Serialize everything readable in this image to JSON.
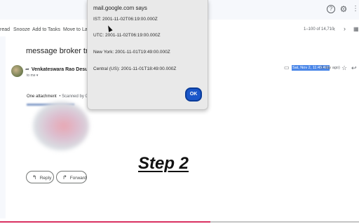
{
  "topbar": {
    "icons": [
      "help-icon",
      "settings-icon",
      "apps-icon"
    ]
  },
  "toolbar": {
    "items": [
      "read",
      "Snooze",
      "Add to Tasks",
      "Move to",
      "La"
    ],
    "pager_text": "1–100 of 14,710"
  },
  "email": {
    "subject": "message broker transa",
    "sender": "Venkateswara Rao Desu",
    "to": "to me",
    "date": "Sat, Nov 2, 11:49 AM",
    "relative": "(1 day ago)",
    "attachment_count": "One attachment",
    "scan_text": "Scanned by G"
  },
  "actions": {
    "reply": "Reply",
    "forward": "Forward"
  },
  "overlay": {
    "step": "Step 2"
  },
  "dialog": {
    "title": "mail.google.com says",
    "lines": [
      "IST: 2001-11-02T06:19:00.000Z",
      "UTC: 2001-11-02T06:19:00.000Z",
      "New York: 2001-11-01T19:49:00.000Z",
      "Central (US): 2001-11-01T18:49:00.000Z"
    ],
    "ok": "OK"
  },
  "colors": {
    "accent": "#1a56c9",
    "highlight": "#4a86e8",
    "progress": "#d93060"
  }
}
